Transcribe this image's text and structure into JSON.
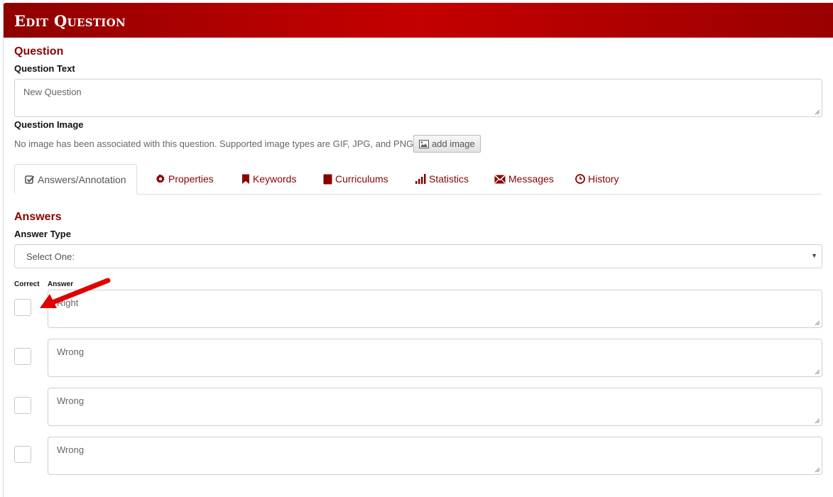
{
  "header": {
    "title": "Edit Question"
  },
  "question": {
    "section_title": "Question",
    "text_label": "Question Text",
    "text_value": "New Question",
    "image_label": "Question Image",
    "image_help": "No image has been associated with this question. Supported image types are GIF, JPG, and PNG.",
    "add_image_label": "add image"
  },
  "tabs": [
    {
      "label": "Answers/Annotation",
      "icon": "check-square-icon",
      "active": true
    },
    {
      "label": "Properties",
      "icon": "gear-icon"
    },
    {
      "label": "Keywords",
      "icon": "bookmark-icon"
    },
    {
      "label": "Curriculums",
      "icon": "book-icon"
    },
    {
      "label": "Statistics",
      "icon": "bar-chart-icon"
    },
    {
      "label": "Messages",
      "icon": "envelope-icon"
    },
    {
      "label": "History",
      "icon": "clock-icon"
    }
  ],
  "answers": {
    "section_title": "Answers",
    "type_label": "Answer Type",
    "type_selected": "Select One:",
    "correct_header": "Correct",
    "answer_header": "Answer",
    "items": [
      {
        "text": "Right",
        "correct": false
      },
      {
        "text": "Wrong",
        "correct": false
      },
      {
        "text": "Wrong",
        "correct": false
      },
      {
        "text": "Wrong",
        "correct": false
      }
    ]
  },
  "colors": {
    "brand": "#b30000",
    "accent_text": "#8b0000",
    "arrow": "#e00000"
  }
}
